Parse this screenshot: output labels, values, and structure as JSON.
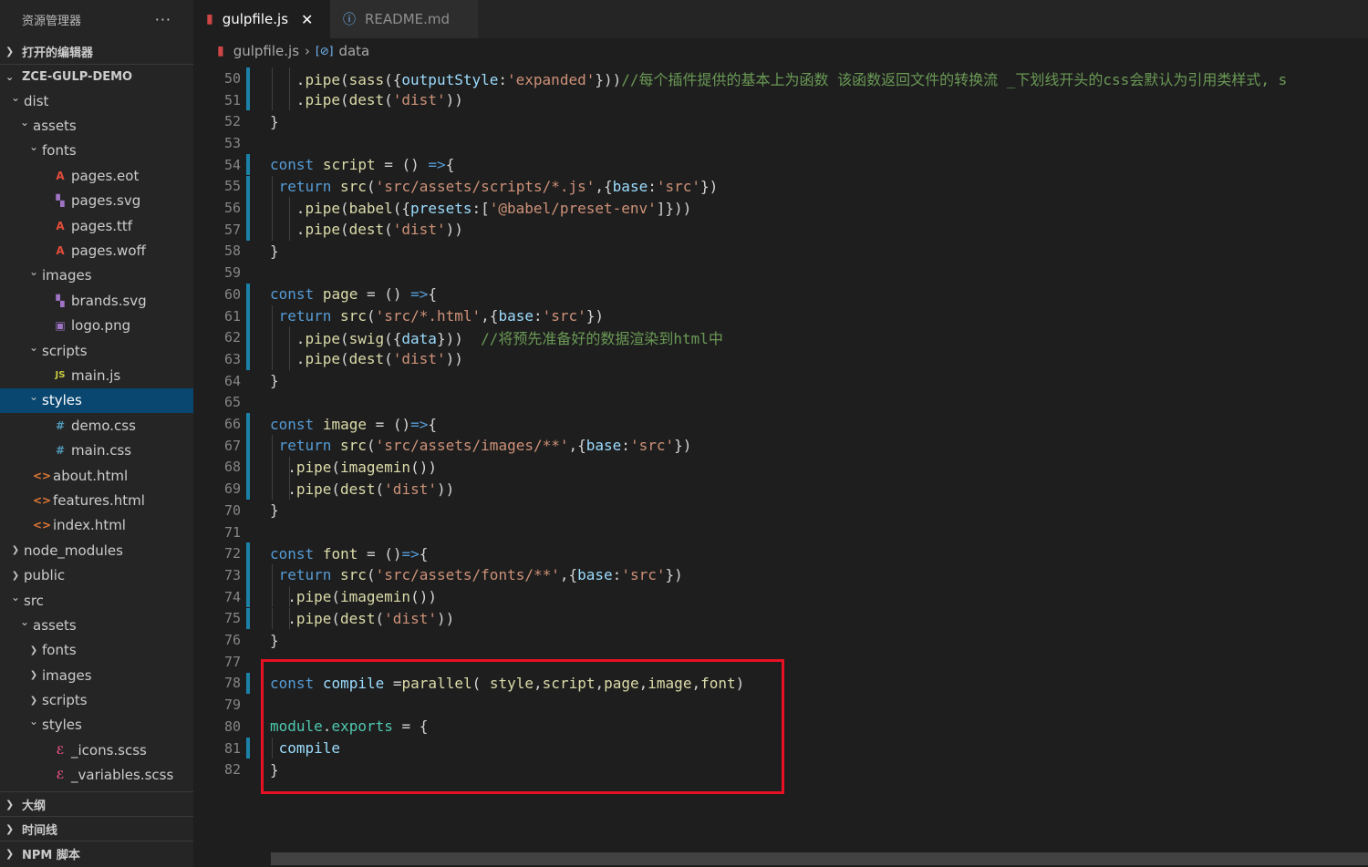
{
  "sidebar": {
    "title": "资源管理器",
    "more": "···",
    "open_editors": "打开的编辑器",
    "project": "ZCE-GULP-DEMO",
    "tree": [
      {
        "label": "dist",
        "depth": 1,
        "twisty": "v",
        "icon": ""
      },
      {
        "label": "assets",
        "depth": 2,
        "twisty": "v",
        "icon": ""
      },
      {
        "label": "fonts",
        "depth": 3,
        "twisty": "v",
        "icon": ""
      },
      {
        "label": "pages.eot",
        "depth": 4,
        "twisty": "",
        "icon": "font-file-icon",
        "glyph": "A",
        "cls": "ic-font"
      },
      {
        "label": "pages.svg",
        "depth": 4,
        "twisty": "",
        "icon": "svg-file-icon",
        "glyph": "▚",
        "cls": "ic-svg"
      },
      {
        "label": "pages.ttf",
        "depth": 4,
        "twisty": "",
        "icon": "font-file-icon",
        "glyph": "A",
        "cls": "ic-font"
      },
      {
        "label": "pages.woff",
        "depth": 4,
        "twisty": "",
        "icon": "font-file-icon",
        "glyph": "A",
        "cls": "ic-font"
      },
      {
        "label": "images",
        "depth": 3,
        "twisty": "v",
        "icon": ""
      },
      {
        "label": "brands.svg",
        "depth": 4,
        "twisty": "",
        "icon": "svg-file-icon",
        "glyph": "▚",
        "cls": "ic-svg"
      },
      {
        "label": "logo.png",
        "depth": 4,
        "twisty": "",
        "icon": "image-file-icon",
        "glyph": "▣",
        "cls": "ic-img"
      },
      {
        "label": "scripts",
        "depth": 3,
        "twisty": "v",
        "icon": ""
      },
      {
        "label": "main.js",
        "depth": 4,
        "twisty": "",
        "icon": "js-file-icon",
        "glyph": "JS",
        "cls": "ic-js"
      },
      {
        "label": "styles",
        "depth": 3,
        "twisty": "v",
        "icon": "",
        "selected": true
      },
      {
        "label": "demo.css",
        "depth": 4,
        "twisty": "",
        "icon": "css-file-icon",
        "glyph": "#",
        "cls": "ic-css"
      },
      {
        "label": "main.css",
        "depth": 4,
        "twisty": "",
        "icon": "css-file-icon",
        "glyph": "#",
        "cls": "ic-css"
      },
      {
        "label": "about.html",
        "depth": 2,
        "twisty": "",
        "icon": "html-file-icon",
        "glyph": "<>",
        "cls": "ic-html"
      },
      {
        "label": "features.html",
        "depth": 2,
        "twisty": "",
        "icon": "html-file-icon",
        "glyph": "<>",
        "cls": "ic-html"
      },
      {
        "label": "index.html",
        "depth": 2,
        "twisty": "",
        "icon": "html-file-icon",
        "glyph": "<>",
        "cls": "ic-html"
      },
      {
        "label": "node_modules",
        "depth": 1,
        "twisty": ">",
        "icon": ""
      },
      {
        "label": "public",
        "depth": 1,
        "twisty": ">",
        "icon": ""
      },
      {
        "label": "src",
        "depth": 1,
        "twisty": "v",
        "icon": ""
      },
      {
        "label": "assets",
        "depth": 2,
        "twisty": "v",
        "icon": ""
      },
      {
        "label": "fonts",
        "depth": 3,
        "twisty": ">",
        "icon": ""
      },
      {
        "label": "images",
        "depth": 3,
        "twisty": ">",
        "icon": ""
      },
      {
        "label": "scripts",
        "depth": 3,
        "twisty": ">",
        "icon": ""
      },
      {
        "label": "styles",
        "depth": 3,
        "twisty": "v",
        "icon": ""
      },
      {
        "label": "_icons.scss",
        "depth": 4,
        "twisty": "",
        "icon": "scss-file-icon",
        "glyph": "ℰ",
        "cls": "ic-scss"
      },
      {
        "label": "_variables.scss",
        "depth": 4,
        "twisty": "",
        "icon": "scss-file-icon",
        "glyph": "ℰ",
        "cls": "ic-scss"
      }
    ],
    "outline": "大纲",
    "timeline": "时间线",
    "npm": "NPM 脚本"
  },
  "tabs": [
    {
      "label": "gulpfile.js",
      "active": true,
      "icon": "gulp-icon"
    },
    {
      "label": "README.md",
      "active": false,
      "icon": "info-icon"
    }
  ],
  "breadcrumb": {
    "file": "gulpfile.js",
    "symbol": "data"
  },
  "code_lines": [
    {
      "n": "50",
      "bar": true,
      "guides": [
        1,
        2
      ],
      "indent": 3,
      "html": "<span class='p'>.</span><span class='f'>pipe</span><span class='p'>(</span><span class='f'>sass</span><span class='p'>({</span><span class='v'>outputStyle</span><span class='p'>:</span><span class='s'>'expanded'</span><span class='p'>}))</span><span class='c'>//每个插件提供的基本上为函数 该函数返回文件的转换流 _下划线开头的css会默认为引用类样式, s</span>"
    },
    {
      "n": "51",
      "bar": true,
      "guides": [
        1,
        2
      ],
      "indent": 3,
      "html": "<span class='p'>.</span><span class='f'>pipe</span><span class='p'>(</span><span class='f'>dest</span><span class='p'>(</span><span class='s'>'dist'</span><span class='p'>))</span>"
    },
    {
      "n": "52",
      "bar": false,
      "guides": [],
      "indent": 0,
      "html": "<span class='p'>}</span>"
    },
    {
      "n": "53",
      "bar": false,
      "guides": [],
      "indent": 0,
      "html": ""
    },
    {
      "n": "54",
      "bar": true,
      "guides": [],
      "indent": 0,
      "html": "<span class='k'>const</span> <span class='f'>script</span> <span class='p'>= () </span><span class='k'>=&gt;</span><span class='p'>{</span>"
    },
    {
      "n": "55",
      "bar": true,
      "guides": [
        1
      ],
      "indent": 1,
      "html": "<span class='k'>return</span> <span class='f'>src</span><span class='p'>(</span><span class='s'>'src/assets/scripts/*.js'</span><span class='p'>,{</span><span class='v'>base</span><span class='p'>:</span><span class='s'>'src'</span><span class='p'>})</span>"
    },
    {
      "n": "56",
      "bar": true,
      "guides": [
        1,
        2
      ],
      "indent": 3,
      "html": "<span class='p'>.</span><span class='f'>pipe</span><span class='p'>(</span><span class='f'>babel</span><span class='p'>({</span><span class='v'>presets</span><span class='p'>:[</span><span class='s'>'@babel/preset-env'</span><span class='p'>]}))</span>"
    },
    {
      "n": "57",
      "bar": true,
      "guides": [
        1,
        2
      ],
      "indent": 3,
      "html": "<span class='p'>.</span><span class='f'>pipe</span><span class='p'>(</span><span class='f'>dest</span><span class='p'>(</span><span class='s'>'dist'</span><span class='p'>))</span>"
    },
    {
      "n": "58",
      "bar": false,
      "guides": [],
      "indent": 0,
      "html": "<span class='p'>}</span>"
    },
    {
      "n": "59",
      "bar": false,
      "guides": [],
      "indent": 0,
      "html": ""
    },
    {
      "n": "60",
      "bar": true,
      "guides": [],
      "indent": 0,
      "html": "<span class='k'>const</span> <span class='f'>page</span> <span class='p'>= () </span><span class='k'>=&gt;</span><span class='p'>{</span>"
    },
    {
      "n": "61",
      "bar": true,
      "guides": [
        1
      ],
      "indent": 1,
      "html": "<span class='k'>return</span> <span class='f'>src</span><span class='p'>(</span><span class='s'>'src/*.html'</span><span class='p'>,{</span><span class='v'>base</span><span class='p'>:</span><span class='s'>'src'</span><span class='p'>})</span>"
    },
    {
      "n": "62",
      "bar": true,
      "guides": [
        1,
        2
      ],
      "indent": 3,
      "html": "<span class='p'>.</span><span class='f'>pipe</span><span class='p'>(</span><span class='f'>swig</span><span class='p'>({</span><span class='v'>data</span><span class='p'>}))  </span><span class='c'>//将预先准备好的数据渲染到html中</span>"
    },
    {
      "n": "63",
      "bar": true,
      "guides": [
        1,
        2
      ],
      "indent": 3,
      "html": "<span class='p'>.</span><span class='f'>pipe</span><span class='p'>(</span><span class='f'>dest</span><span class='p'>(</span><span class='s'>'dist'</span><span class='p'>))</span>"
    },
    {
      "n": "64",
      "bar": false,
      "guides": [],
      "indent": 0,
      "html": "<span class='p'>}</span>"
    },
    {
      "n": "65",
      "bar": false,
      "guides": [],
      "indent": 0,
      "html": ""
    },
    {
      "n": "66",
      "bar": true,
      "guides": [],
      "indent": 0,
      "html": "<span class='k'>const</span> <span class='f'>image</span> <span class='p'>= ()</span><span class='k'>=&gt;</span><span class='p'>{</span>"
    },
    {
      "n": "67",
      "bar": true,
      "guides": [
        1
      ],
      "indent": 1,
      "html": "<span class='k'>return</span> <span class='f'>src</span><span class='p'>(</span><span class='s'>'src/assets/images/**'</span><span class='p'>,{</span><span class='v'>base</span><span class='p'>:</span><span class='s'>'src'</span><span class='p'>})</span>"
    },
    {
      "n": "68",
      "bar": true,
      "guides": [
        1,
        2
      ],
      "indent": 2,
      "html": "<span class='p'>.</span><span class='f'>pipe</span><span class='p'>(</span><span class='f'>imagemin</span><span class='p'>())</span>"
    },
    {
      "n": "69",
      "bar": true,
      "guides": [
        1,
        2
      ],
      "indent": 2,
      "html": "<span class='p'>.</span><span class='f'>pipe</span><span class='p'>(</span><span class='f'>dest</span><span class='p'>(</span><span class='s'>'dist'</span><span class='p'>))</span>"
    },
    {
      "n": "70",
      "bar": false,
      "guides": [],
      "indent": 0,
      "html": "<span class='p'>}</span>"
    },
    {
      "n": "71",
      "bar": false,
      "guides": [],
      "indent": 0,
      "html": ""
    },
    {
      "n": "72",
      "bar": true,
      "guides": [],
      "indent": 0,
      "html": "<span class='k'>const</span> <span class='f'>font</span> <span class='p'>= ()</span><span class='k'>=&gt;</span><span class='p'>{</span>"
    },
    {
      "n": "73",
      "bar": true,
      "guides": [
        1
      ],
      "indent": 1,
      "html": "<span class='k'>return</span> <span class='f'>src</span><span class='p'>(</span><span class='s'>'src/assets/fonts/**'</span><span class='p'>,{</span><span class='v'>base</span><span class='p'>:</span><span class='s'>'src'</span><span class='p'>})</span>"
    },
    {
      "n": "74",
      "bar": true,
      "guides": [
        1,
        2
      ],
      "indent": 2,
      "html": "<span class='p'>.</span><span class='f'>pipe</span><span class='p'>(</span><span class='f'>imagemin</span><span class='p'>())</span>"
    },
    {
      "n": "75",
      "bar": true,
      "guides": [
        1,
        2
      ],
      "indent": 2,
      "html": "<span class='p'>.</span><span class='f'>pipe</span><span class='p'>(</span><span class='f'>dest</span><span class='p'>(</span><span class='s'>'dist'</span><span class='p'>))</span>"
    },
    {
      "n": "76",
      "bar": false,
      "guides": [],
      "indent": 0,
      "html": "<span class='p'>}</span>"
    },
    {
      "n": "77",
      "bar": false,
      "guides": [],
      "indent": 0,
      "html": ""
    },
    {
      "n": "78",
      "bar": true,
      "guides": [],
      "indent": 0,
      "html": "<span class='k'>const</span> <span class='v'>compile</span> <span class='p'>=</span><span class='f'>parallel</span><span class='p'>( </span><span class='f'>style</span><span class='p'>,</span><span class='f'>script</span><span class='p'>,</span><span class='f'>page</span><span class='p'>,</span><span class='f'>image</span><span class='p'>,</span><span class='f'>font</span><span class='p'>)</span>"
    },
    {
      "n": "79",
      "bar": false,
      "guides": [],
      "indent": 0,
      "html": ""
    },
    {
      "n": "80",
      "bar": false,
      "guides": [],
      "indent": 0,
      "html": "<span class='m'>module</span><span class='p'>.</span><span class='m'>exports</span> <span class='p'>= {</span>"
    },
    {
      "n": "81",
      "bar": true,
      "guides": [
        1
      ],
      "indent": 1,
      "html": "<span class='v'>compile</span>"
    },
    {
      "n": "82",
      "bar": false,
      "guides": [],
      "indent": 0,
      "html": "<span class='p'>}</span>"
    }
  ]
}
